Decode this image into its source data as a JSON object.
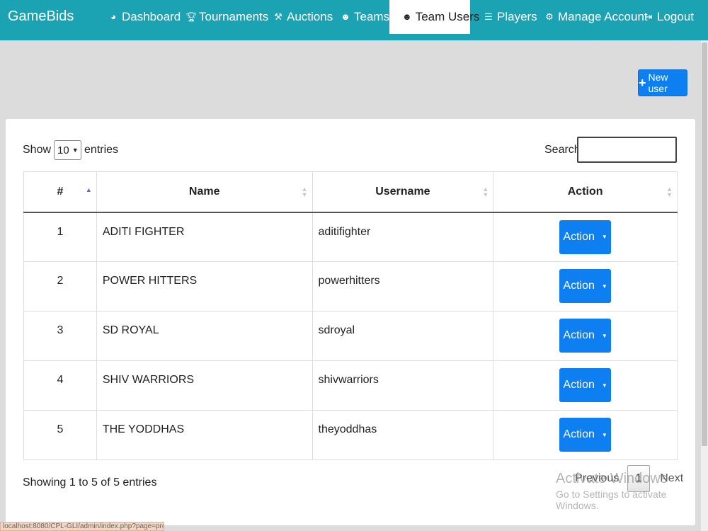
{
  "app": {
    "brand": "GameBids"
  },
  "nav": {
    "items": [
      {
        "label": "Dashboard",
        "icon": "dashboard-icon"
      },
      {
        "label": "Tournaments",
        "icon": "trophy-icon"
      },
      {
        "label": "Auctions",
        "icon": "gavel-icon"
      },
      {
        "label": "Teams",
        "icon": "users-icon"
      },
      {
        "label": "Team Users",
        "icon": "users-icon",
        "active": true
      },
      {
        "label": "Players",
        "icon": "list-icon"
      },
      {
        "label": "Manage Account",
        "icon": "gear-icon"
      },
      {
        "label": "Logout",
        "icon": "logout-icon"
      }
    ]
  },
  "toolbar": {
    "new_user_label": "New user"
  },
  "table_controls": {
    "show_label": "Show",
    "entries_label": "entries",
    "length_value": "10",
    "search_label": "Search:",
    "search_value": ""
  },
  "table": {
    "columns": [
      "#",
      "Name",
      "Username",
      "Action"
    ],
    "rows": [
      {
        "idx": "1",
        "name": "ADITI FIGHTER",
        "username": "aditifighter",
        "action": "Action"
      },
      {
        "idx": "2",
        "name": "POWER HITTERS",
        "username": "powerhitters",
        "action": "Action"
      },
      {
        "idx": "3",
        "name": "SD ROYAL",
        "username": "sdroyal",
        "action": "Action"
      },
      {
        "idx": "4",
        "name": "SHIV WARRIORS",
        "username": "shivwarriors",
        "action": "Action"
      },
      {
        "idx": "5",
        "name": "THE YODDHAS",
        "username": "theyoddhas",
        "action": "Action"
      }
    ]
  },
  "footer": {
    "info": "Showing 1 to 5 of 5 entries",
    "prev": "Previous",
    "page": "1",
    "next": "Next"
  },
  "watermark": {
    "line1": "Activate Windows",
    "line2": "Go to Settings to activate Windows."
  },
  "status_url": "localhost:8080/CPL-GLI/admin/index.php?page=products",
  "colors": {
    "navbar": "#1ba3b4",
    "primary": "#0d7ff0",
    "background": "#dcdcdc"
  }
}
